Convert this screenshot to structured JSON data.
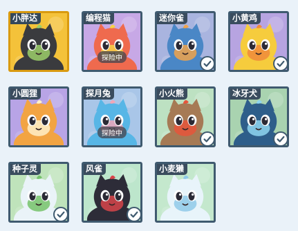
{
  "pets": [
    {
      "name": "小胖达",
      "status": "",
      "collected": false,
      "bg": "#f4c23a",
      "body": "#3a3b3e",
      "accent": "#9ccf6a",
      "selected": true,
      "icon": "panda-icon"
    },
    {
      "name": "编程猫",
      "status": "探险中",
      "collected": false,
      "bg": "#c7a8e6",
      "body": "#ef6a4e",
      "accent": "#f6d148",
      "selected": false,
      "icon": "cat-icon"
    },
    {
      "name": "迷你雀",
      "status": "",
      "collected": true,
      "bg": "#a9b4df",
      "body": "#4a87c6",
      "accent": "#f0a34a",
      "selected": false,
      "icon": "bird-icon"
    },
    {
      "name": "小黄鸡",
      "status": "",
      "collected": true,
      "bg": "#b7a4e1",
      "body": "#f6cc3d",
      "accent": "#f08a3b",
      "selected": false,
      "icon": "chick-icon"
    },
    {
      "name": "小圆狸",
      "status": "",
      "collected": false,
      "bg": "#b8a4e6",
      "body": "#f2a443",
      "accent": "#fff0c8",
      "selected": false,
      "icon": "raccoon-icon"
    },
    {
      "name": "探月兔",
      "status": "探险中",
      "collected": false,
      "bg": "#a9c6e8",
      "body": "#57b6e6",
      "accent": "#f1a6b7",
      "selected": false,
      "icon": "rabbit-icon"
    },
    {
      "name": "小火熊",
      "status": "",
      "collected": true,
      "bg": "#bde1c2",
      "body": "#a67a55",
      "accent": "#e6553b",
      "selected": false,
      "icon": "bear-icon"
    },
    {
      "name": "冰牙犬",
      "status": "",
      "collected": true,
      "bg": "#a9d3b0",
      "body": "#2e5e8a",
      "accent": "#8fd6f0",
      "selected": false,
      "icon": "dog-icon"
    },
    {
      "name": "种子灵",
      "status": "",
      "collected": true,
      "bg": "#bfe3bb",
      "body": "#eaf3f8",
      "accent": "#75c26a",
      "selected": false,
      "icon": "sprout-icon"
    },
    {
      "name": "风雀",
      "status": "",
      "collected": true,
      "bg": "#bde6cc",
      "body": "#2d2c38",
      "accent": "#d8454a",
      "selected": false,
      "icon": "swallow-icon"
    },
    {
      "name": "小麦獭",
      "status": "",
      "collected": false,
      "bg": "#c4e8cd",
      "body": "#e8f4fa",
      "accent": "#8fc9e8",
      "selected": false,
      "icon": "otter-icon"
    }
  ],
  "colors": {
    "border": "#3f5a6f",
    "check": "#3f5a6f"
  }
}
